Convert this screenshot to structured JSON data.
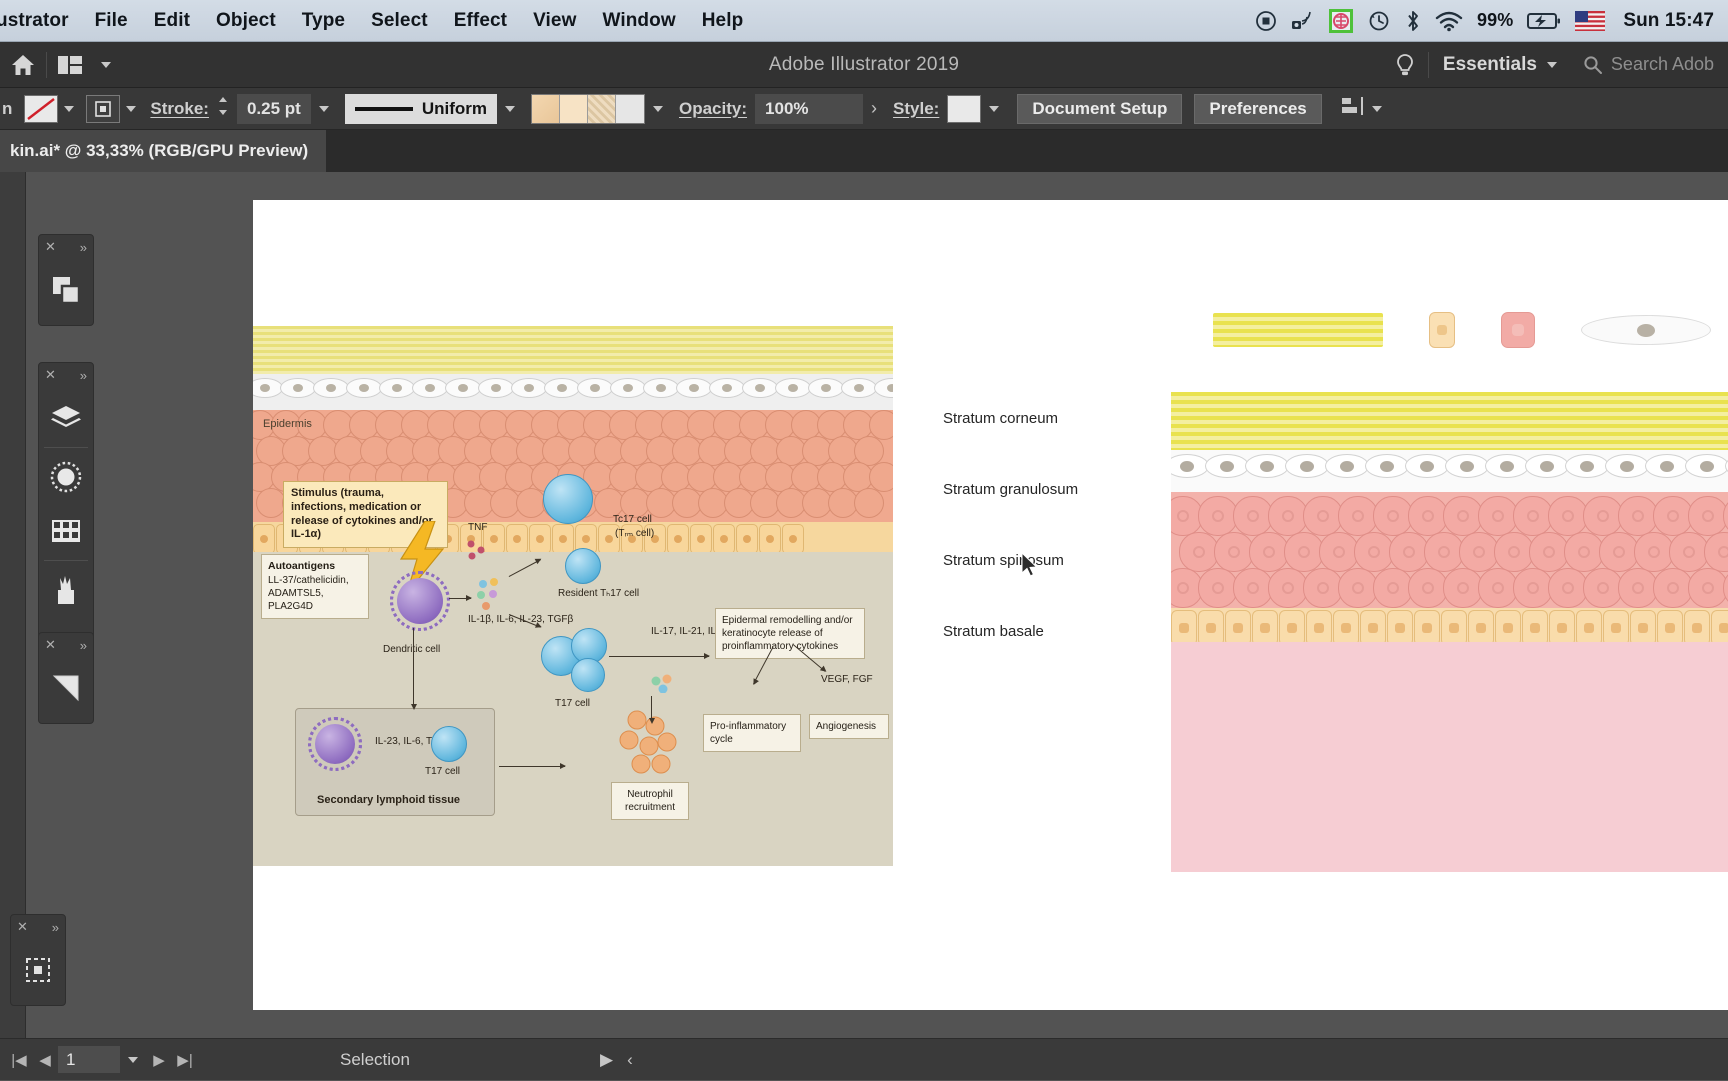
{
  "menubar": {
    "app_name": "ustrator",
    "items": [
      "File",
      "Edit",
      "Object",
      "Type",
      "Select",
      "Effect",
      "View",
      "Window",
      "Help"
    ],
    "status_icons": [
      "record-icon",
      "screencast-icon",
      "app-green-icon",
      "time-machine-icon",
      "bluetooth-icon",
      "wifi-icon"
    ],
    "battery_percent": "99%",
    "battery_icon": "battery-charging-icon",
    "flag_icon": "us-flag-icon",
    "clock": "Sun 15:47"
  },
  "app_header": {
    "home_icon": "home-icon",
    "arrange_icon": "arrange-documents-icon",
    "arrange_caret_icon": "chevron-down-icon",
    "title": "Adobe Illustrator 2019",
    "tips_icon": "lightbulb-icon",
    "workspace": "Essentials",
    "workspace_caret_icon": "chevron-down-icon",
    "search_icon": "search-icon",
    "search_placeholder": "Search Adob"
  },
  "control_bar": {
    "selection_label": "n",
    "fill_swatch": "none-fill-swatch",
    "fill_caret_icon": "chevron-down-icon",
    "stroke_swatch": "stroke-swatch",
    "stroke_caret_icon": "chevron-down-icon",
    "stroke_label": "Stroke:",
    "stroke_stepper_icon": "stepper-icon",
    "stroke_weight": "0.25 pt",
    "stroke_weight_caret_icon": "chevron-down-icon",
    "stroke_profile": "Uniform",
    "stroke_profile_caret_icon": "chevron-down-icon",
    "brush_caret_icon": "chevron-down-icon",
    "opacity_label": "Opacity:",
    "opacity_value": "100%",
    "opacity_more_icon": "chevron-right-icon",
    "style_label": "Style:",
    "style_caret_icon": "chevron-down-icon",
    "document_setup": "Document Setup",
    "preferences": "Preferences",
    "align_icon": "align-icon",
    "align_caret_icon": "chevron-down-icon"
  },
  "tabbar": {
    "doc_title": "kin.ai* @ 33,33% (RGB/GPU Preview)"
  },
  "panel_docks": [
    {
      "close_icon": "close-icon",
      "expand_icon": "double-chevron-icon",
      "icons": [
        "pathfinder-icon"
      ]
    },
    {
      "close_icon": "close-icon",
      "expand_icon": "double-chevron-icon",
      "icons": [
        "layers-icon",
        "color-wheel-icon",
        "swatches-icon",
        "brushes-icon",
        "symbols-icon"
      ]
    },
    {
      "close_icon": "close-icon",
      "expand_icon": "double-chevron-icon",
      "icons": [
        "gradient-icon"
      ]
    }
  ],
  "bottom_dock": {
    "close_icon": "close-icon",
    "expand_icon": "double-chevron-icon",
    "icons": [
      "artboards-icon"
    ]
  },
  "statusbar": {
    "first_icon": "first-artboard-icon",
    "prev_icon": "prev-artboard-icon",
    "artboard_number": "1",
    "artboard_caret_icon": "chevron-down-icon",
    "next_icon": "next-artboard-icon",
    "last_icon": "last-artboard-icon",
    "tool_status": "Selection",
    "play_icon": "play-icon",
    "back_icon": "chevron-left-icon"
  },
  "artwork": {
    "left_diagram": {
      "title_label": "Epidermis",
      "stimulus_callout": "Stimulus (trauma, infections, medication or release of cytokines and/or IL-1α)",
      "autoantigens_title": "Autoantigens",
      "autoantigens_list": "LL-37/cathelicidin, ADAMTSL5, PLA2G4D",
      "dendritic_label": "Dendritic cell",
      "tnf_label": "TNF",
      "cytokine_cluster": "IL-1β, IL-6, IL-23, TGFβ",
      "tc17_label": "Tc17 cell",
      "trm_label": "(Tᵣₘ cell)",
      "resident_label": "Resident Tₕ17 cell",
      "th17_label": "T17 cell",
      "il_cluster": "IL-17, IL-21, IL-22",
      "remodelling_box": "Epidermal remodelling and/or keratinocyte release of proinflammatory cytokines",
      "vegf_label": "VEGF, FGF",
      "proinflam_box": "Pro-inflammatory cycle",
      "angiogenesis_box": "Angiogenesis",
      "neutrophil_box": "Neutrophil recruitment",
      "lymphoid_label": "Secondary lymphoid tissue",
      "lymphoid_cytokines": "IL-23, IL-6, TGFβ",
      "lymphoid_t17": "T17 cell"
    },
    "right_diagram": {
      "layer_labels": [
        "Stratum corneum",
        "Stratum granulosum",
        "Stratum spinosum",
        "Stratum basale"
      ],
      "thumbnail_names": [
        "corneum-swatch",
        "basale-cell-swatch",
        "spinosum-cell-swatch",
        "granulosum-cell-swatch"
      ]
    }
  },
  "colors": {
    "menubar_bg": "#d3dce6",
    "app_chrome": "#323232",
    "control_bar": "#383838",
    "canvas_bg": "#ffffff",
    "workspace_bg": "#535353",
    "corneum_yellow": "#e9e24f",
    "spinosum_pink": "#f3b2ab",
    "basale_tan": "#f8dcae",
    "dermis_pink": "#f6cdd3",
    "tcell_blue": "#5fb6dd",
    "dendritic_purple": "#8e6cc0"
  }
}
